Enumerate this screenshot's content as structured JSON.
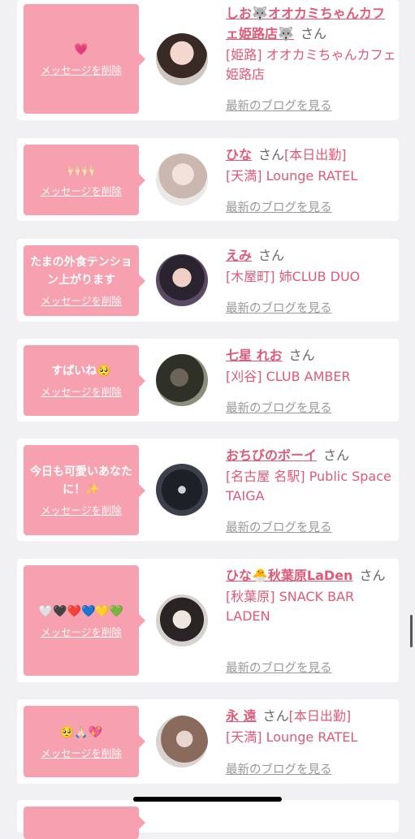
{
  "cards": [
    {
      "name": "しお🐺オオカミちゃんカフェ姫路店🐺",
      "san": "さん",
      "tag": "",
      "shop": "[姫路] オオカミちゃんカフェ姫路店",
      "message": "💗",
      "delete_label": "メッセージを削除",
      "blog_label": "最新のブログを見る"
    },
    {
      "name": "ひな",
      "san": "さん",
      "tag": "[本日出勤]",
      "shop": "[天満] Lounge RATEL",
      "message": "🙌🏻🙌🏻",
      "delete_label": "メッセージを削除",
      "blog_label": "最新のブログを見る"
    },
    {
      "name": "えみ",
      "san": "さん",
      "tag": "",
      "shop": "[木屋町] 姉CLUB DUO",
      "message": "たまの外食テンション上がります",
      "delete_label": "メッセージを削除",
      "blog_label": "最新のブログを見る"
    },
    {
      "name": "七星 れお",
      "san": "さん",
      "tag": "",
      "shop": "[刈谷] CLUB AMBER",
      "message": "すぱいね🥺",
      "delete_label": "メッセージを削除",
      "blog_label": "最新のブログを見る"
    },
    {
      "name": "おちびのボーイ",
      "san": "さん",
      "tag": "",
      "shop": "[名古屋 名駅] Public Space TAIGA",
      "message": "今日も可愛いあなたに！✨",
      "delete_label": "メッセージを削除",
      "blog_label": "最新のブログを見る"
    },
    {
      "name": "ひな🐣秋葉原LaDen",
      "san": "さん",
      "tag": "",
      "shop": "[秋葉原] SNACK BAR LADEN",
      "message": "🤍🖤❤️💙💛💚",
      "delete_label": "メッセージを削除",
      "blog_label": "最新のブログを見る"
    },
    {
      "name": "永 遠",
      "san": "さん",
      "tag": "[本日出勤]",
      "shop": "[天満] Lounge RATEL",
      "message": "🥺🙏🏻💖",
      "delete_label": "メッセージを削除",
      "blog_label": "最新のブログを見る"
    }
  ]
}
